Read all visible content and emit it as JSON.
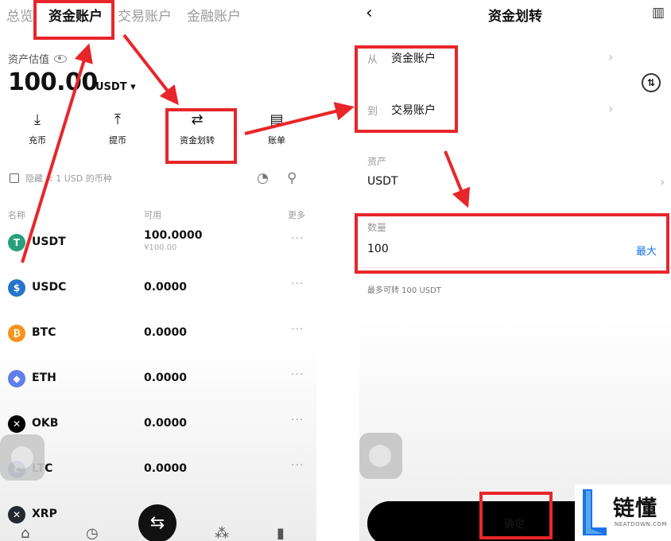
{
  "colors": {
    "annotation": "#e8262a",
    "link": "#1a73e8",
    "tether": "#26a17b",
    "usdc": "#2775ca",
    "btc": "#f7931a",
    "eth": "#627eea",
    "okb": "#000000",
    "ltc": "#345d9d",
    "xrp": "#23292f"
  },
  "left": {
    "tabs": [
      "总览",
      "资金账户",
      "交易账户",
      "金融账户"
    ],
    "asset_estimate_label": "资产估值",
    "balance": "100.00",
    "balance_unit": "USDT ▾",
    "actions": [
      {
        "label": "充币",
        "icon": "deposit-icon"
      },
      {
        "label": "提币",
        "icon": "withdraw-icon"
      },
      {
        "label": "资金划转",
        "icon": "transfer-icon"
      },
      {
        "label": "账单",
        "icon": "bill-icon"
      }
    ],
    "hide_small_label": "隐藏 < 1 USD 的币种",
    "columns": {
      "name": "名称",
      "available": "可用",
      "more": "更多"
    },
    "coins": [
      {
        "symbol": "USDT",
        "amount": "100.0000",
        "sub": "¥100.00",
        "logo": "T"
      },
      {
        "symbol": "USDC",
        "amount": "0.0000",
        "sub": "",
        "logo": "$"
      },
      {
        "symbol": "BTC",
        "amount": "0.0000",
        "sub": "",
        "logo": "₿"
      },
      {
        "symbol": "ETH",
        "amount": "0.0000",
        "sub": "",
        "logo": "◆"
      },
      {
        "symbol": "OKB",
        "amount": "0.0000",
        "sub": "",
        "logo": "✕"
      },
      {
        "symbol": "LTC",
        "amount": "0.0000",
        "sub": "",
        "logo": "Ł"
      },
      {
        "symbol": "XRP",
        "amount": "0.0000",
        "sub": "",
        "logo": "✕"
      }
    ],
    "more_glyph": "···"
  },
  "right": {
    "title": "资金划转",
    "from_label": "从",
    "from_account": "资金账户",
    "to_label": "到",
    "to_account": "交易账户",
    "asset_label": "资产",
    "asset_value": "USDT",
    "quantity_label": "数量",
    "quantity_value": "100",
    "max_label": "最大",
    "max_transferable": "最多可转 100 USDT",
    "confirm_label": "确定"
  },
  "watermark": {
    "cn": "链懂",
    "en": "NEATDOWN.COM"
  }
}
